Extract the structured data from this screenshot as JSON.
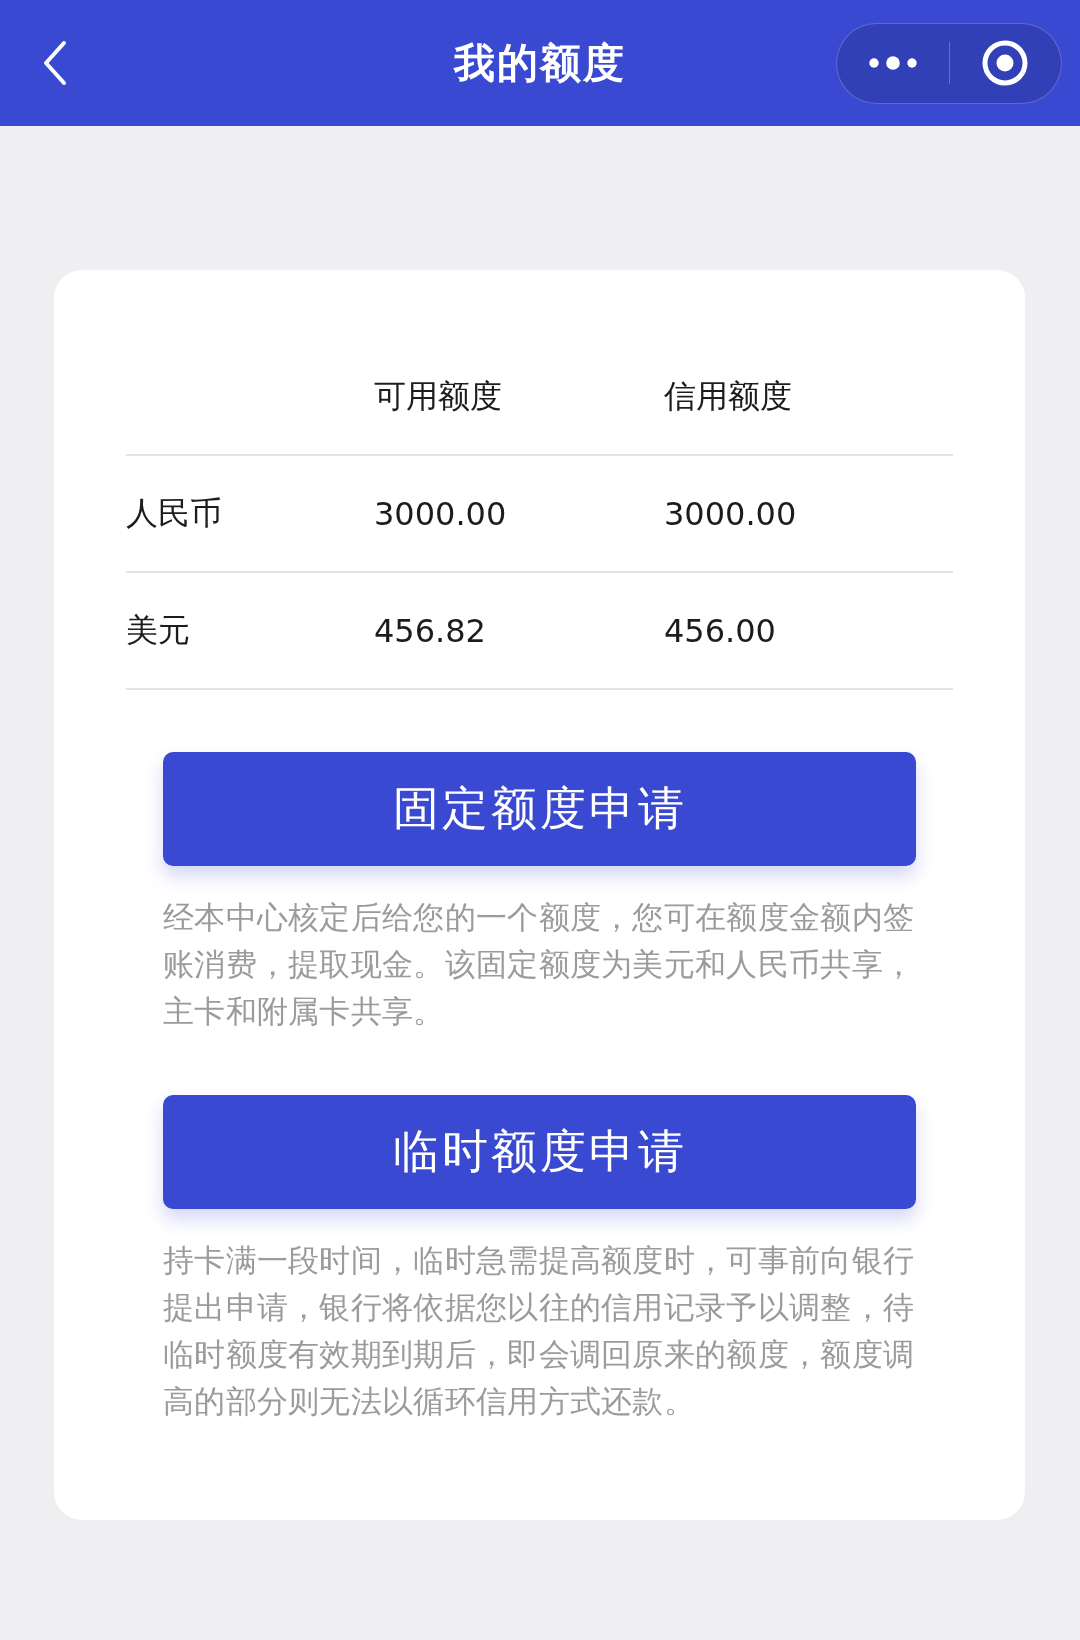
{
  "nav_bar": {
    "title": "我的额度"
  },
  "limits_table": {
    "columns": [
      "可用额度",
      "信用额度"
    ],
    "rows": [
      {
        "currency": "人民币",
        "available": "3000.00",
        "credit": "3000.00"
      },
      {
        "currency": "美元",
        "available": "456.82",
        "credit": "456.00"
      }
    ]
  },
  "applications": [
    {
      "button": "固定额度申请",
      "description": "经本中心核定后给您的一个额度，您可在额度金额内签账消费，提取现金。该固定额度为美元和人民币共享，主卡和附属卡共享。"
    },
    {
      "button": "临时额度申请",
      "description": "持卡满一段时间，临时急需提高额度时，可事前向银行提出申请，银行将依据您以往的信用记录予以调整，待临时额度有效期到期后，即会调回原来的额度，额度调高的部分则无法以循环信用方式还款。"
    }
  ]
}
